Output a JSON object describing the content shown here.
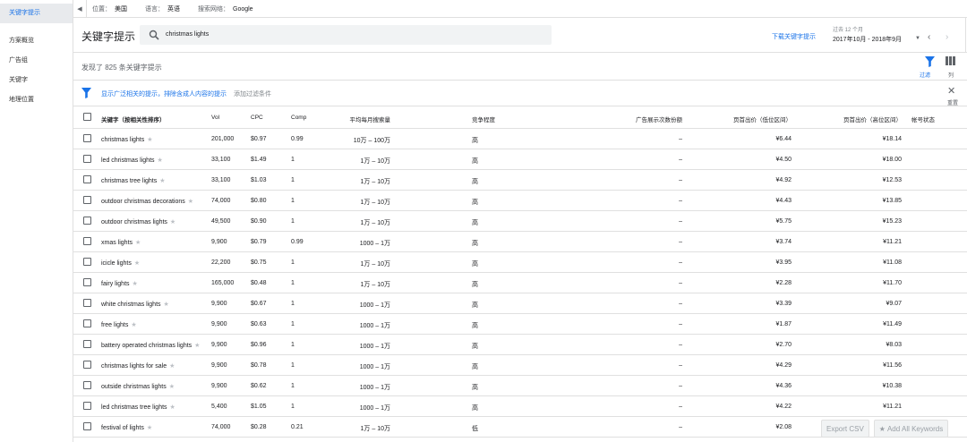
{
  "sidebar": {
    "items": [
      {
        "label": "关键字提示",
        "active": true
      },
      {
        "label": "方案概览",
        "active": false
      },
      {
        "label": "广告组",
        "active": false
      },
      {
        "label": "关键字",
        "active": false
      },
      {
        "label": "地理位置",
        "active": false
      }
    ]
  },
  "topbar": {
    "location_label": "位置：",
    "location_value": "美国",
    "language_label": "语言：",
    "language_value": "英语",
    "network_label": "搜索网络：",
    "network_value": "Google"
  },
  "header": {
    "title": "关键字提示",
    "search_value": "christmas lights",
    "download_label": "下载关键字提示",
    "period_label": "过去 12 个月",
    "period_value": "2017年10月 - 2018年9月"
  },
  "summary": {
    "count_text": "发现了 825 条关键字提示",
    "filter_label": "过滤",
    "columns_label": "列"
  },
  "filterbar": {
    "link_text": "显示广泛相关的提示，排除含成人内容的提示",
    "add_text": "添加过滤条件",
    "reset_label": "重置"
  },
  "table": {
    "headers": {
      "keyword": "关键字（按相关性排序）",
      "vol": "Vol",
      "cpc": "CPC",
      "comp": "Comp",
      "avg_searches": "平均每月搜索量",
      "competition": "竞争程度",
      "impr_share": "广告展示次数份额",
      "bid_low": "页首出价（低位区间）",
      "bid_high": "页首出价（高位区间）",
      "account_status": "帐号状态"
    },
    "rows": [
      {
        "keyword": "christmas lights",
        "vol": "201,000",
        "cpc": "$0.97",
        "comp": "0.99",
        "avg": "10万 – 100万",
        "competition": "高",
        "share": "–",
        "low": "¥6.44",
        "high": "¥18.14"
      },
      {
        "keyword": "led christmas lights",
        "vol": "33,100",
        "cpc": "$1.49",
        "comp": "1",
        "avg": "1万 – 10万",
        "competition": "高",
        "share": "–",
        "low": "¥4.50",
        "high": "¥18.00"
      },
      {
        "keyword": "christmas tree lights",
        "vol": "33,100",
        "cpc": "$1.03",
        "comp": "1",
        "avg": "1万 – 10万",
        "competition": "高",
        "share": "–",
        "low": "¥4.92",
        "high": "¥12.53"
      },
      {
        "keyword": "outdoor christmas decorations",
        "vol": "74,000",
        "cpc": "$0.80",
        "comp": "1",
        "avg": "1万 – 10万",
        "competition": "高",
        "share": "–",
        "low": "¥4.43",
        "high": "¥13.85"
      },
      {
        "keyword": "outdoor christmas lights",
        "vol": "49,500",
        "cpc": "$0.90",
        "comp": "1",
        "avg": "1万 – 10万",
        "competition": "高",
        "share": "–",
        "low": "¥5.75",
        "high": "¥15.23"
      },
      {
        "keyword": "xmas lights",
        "vol": "9,900",
        "cpc": "$0.79",
        "comp": "0.99",
        "avg": "1000 – 1万",
        "competition": "高",
        "share": "–",
        "low": "¥3.74",
        "high": "¥11.21"
      },
      {
        "keyword": "icicle lights",
        "vol": "22,200",
        "cpc": "$0.75",
        "comp": "1",
        "avg": "1万 – 10万",
        "competition": "高",
        "share": "–",
        "low": "¥3.95",
        "high": "¥11.08"
      },
      {
        "keyword": "fairy lights",
        "vol": "165,000",
        "cpc": "$0.48",
        "comp": "1",
        "avg": "1万 – 10万",
        "competition": "高",
        "share": "–",
        "low": "¥2.28",
        "high": "¥11.70"
      },
      {
        "keyword": "white christmas lights",
        "vol": "9,900",
        "cpc": "$0.67",
        "comp": "1",
        "avg": "1000 – 1万",
        "competition": "高",
        "share": "–",
        "low": "¥3.39",
        "high": "¥9.07"
      },
      {
        "keyword": "free lights",
        "vol": "9,900",
        "cpc": "$0.63",
        "comp": "1",
        "avg": "1000 – 1万",
        "competition": "高",
        "share": "–",
        "low": "¥1.87",
        "high": "¥11.49"
      },
      {
        "keyword": "battery operated christmas lights",
        "vol": "9,900",
        "cpc": "$0.96",
        "comp": "1",
        "avg": "1000 – 1万",
        "competition": "高",
        "share": "–",
        "low": "¥2.70",
        "high": "¥8.03"
      },
      {
        "keyword": "christmas lights for sale",
        "vol": "9,900",
        "cpc": "$0.78",
        "comp": "1",
        "avg": "1000 – 1万",
        "competition": "高",
        "share": "–",
        "low": "¥4.29",
        "high": "¥11.56"
      },
      {
        "keyword": "outside christmas lights",
        "vol": "9,900",
        "cpc": "$0.62",
        "comp": "1",
        "avg": "1000 – 1万",
        "competition": "高",
        "share": "–",
        "low": "¥4.36",
        "high": "¥10.38"
      },
      {
        "keyword": "led christmas tree lights",
        "vol": "5,400",
        "cpc": "$1.05",
        "comp": "1",
        "avg": "1000 – 1万",
        "competition": "高",
        "share": "–",
        "low": "¥4.22",
        "high": "¥11.21"
      },
      {
        "keyword": "festival of lights",
        "vol": "74,000",
        "cpc": "$0.28",
        "comp": "0.21",
        "avg": "1万 – 10万",
        "competition": "低",
        "share": "–",
        "low": "¥2.08",
        "high": ""
      }
    ]
  },
  "actions": {
    "export_label": "Export CSV",
    "add_all_label": "Add All Keywords"
  },
  "colors": {
    "accent": "#1a73e8",
    "active_bg": "#e8eaed"
  }
}
